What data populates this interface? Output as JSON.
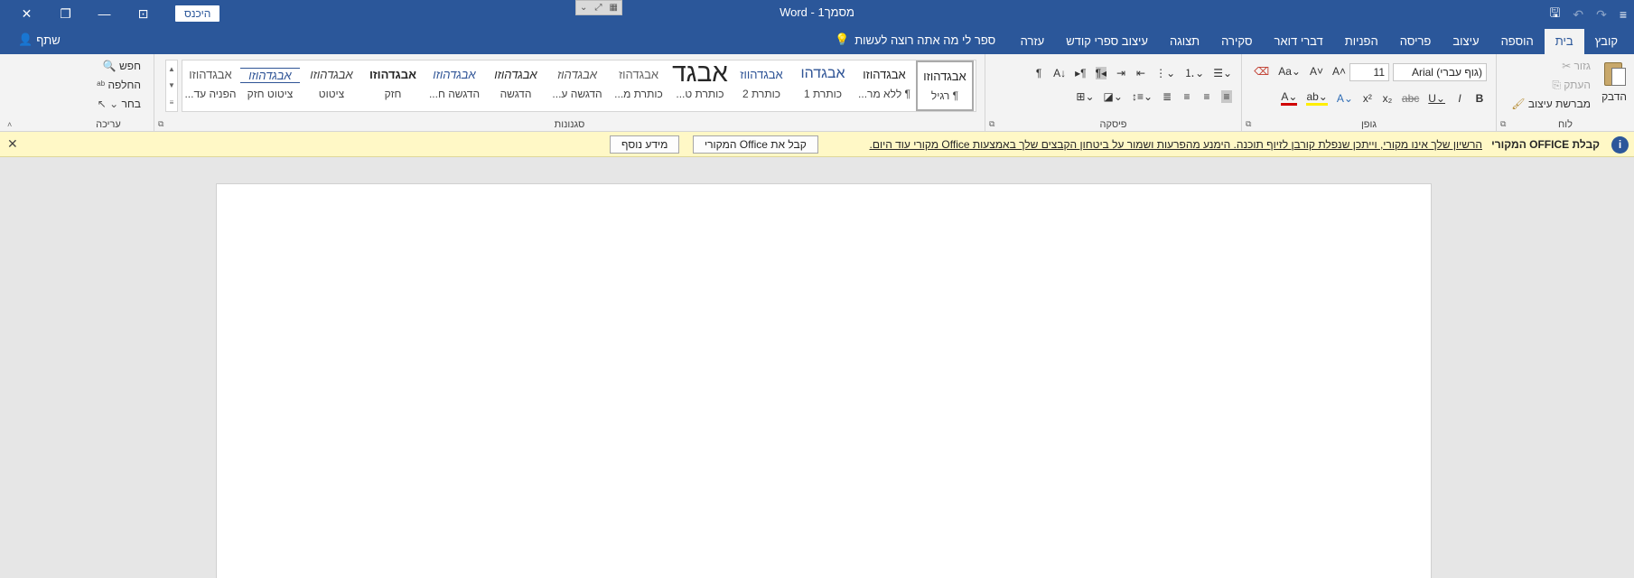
{
  "app": {
    "title": "מסמך1  -  Word",
    "signin_label": "היכנס"
  },
  "tabs": [
    {
      "label": "קובץ"
    },
    {
      "label": "בית"
    },
    {
      "label": "הוספה"
    },
    {
      "label": "עיצוב"
    },
    {
      "label": "פריסה"
    },
    {
      "label": "הפניות"
    },
    {
      "label": "דברי דואר"
    },
    {
      "label": "סקירה"
    },
    {
      "label": "תצוגה"
    },
    {
      "label": "עיצוב ספרי קודש"
    },
    {
      "label": "עזרה"
    }
  ],
  "tell_me": "ספר לי מה אתה רוצה לעשות",
  "share_label": "שתף",
  "clipboard": {
    "paste_label": "הדבק",
    "cut_label": "גזור",
    "copy_label": "העתק",
    "format_painter_label": "מברשת עיצוב",
    "group_label": "לוח"
  },
  "font": {
    "font_name": "(גוף עברי) Arial",
    "font_size": "11",
    "group_label": "גופן"
  },
  "paragraph": {
    "group_label": "פיסקה"
  },
  "styles": {
    "group_label": "סגנונות",
    "items": [
      {
        "sample": "אבגדהוזו",
        "name": "¶ רגיל"
      },
      {
        "sample": "אבגדהוזו",
        "name": "¶ ללא מר..."
      },
      {
        "sample": "אבגדהו",
        "name": "כותרת 1"
      },
      {
        "sample": "אבגדהווז",
        "name": "כותרת 2"
      },
      {
        "sample": "אבגד",
        "name": "כותרת ט..."
      },
      {
        "sample": "אבגדהוז",
        "name": "כותרת מ..."
      },
      {
        "sample": "אבגדהוז",
        "name": "הדגשה ע..."
      },
      {
        "sample": "אבגדהוזו",
        "name": "הדגשה"
      },
      {
        "sample": "אבגדהוזו",
        "name": "הדגשה ח..."
      },
      {
        "sample": "אבגדהוזו",
        "name": "חזק"
      },
      {
        "sample": "אבגדהוזו",
        "name": "ציטוט"
      },
      {
        "sample": "אבגדהוזו",
        "name": "ציטוט חזק"
      },
      {
        "sample": "אבגדהוזו",
        "name": "הפניה עד..."
      }
    ]
  },
  "editing": {
    "find_label": "חפש",
    "replace_label": "החלפה",
    "select_label": "בחר",
    "group_label": "עריכה"
  },
  "message_bar": {
    "title": "קבלת OFFICE המקורי",
    "text": "הרשיון שלך אינו מקורי, וייתכן שנפלת קורבן לזיוף תוכנה. הימנע מהפרעות ושמור על ביטחון הקבצים שלך באמצעות Office מקורי עוד היום.",
    "get_genuine_label": "קבל את Office המקורי",
    "learn_more_label": "מידע נוסף"
  },
  "colors": {
    "brand": "#2b579a",
    "message_bar_bg": "#fff8c6"
  }
}
